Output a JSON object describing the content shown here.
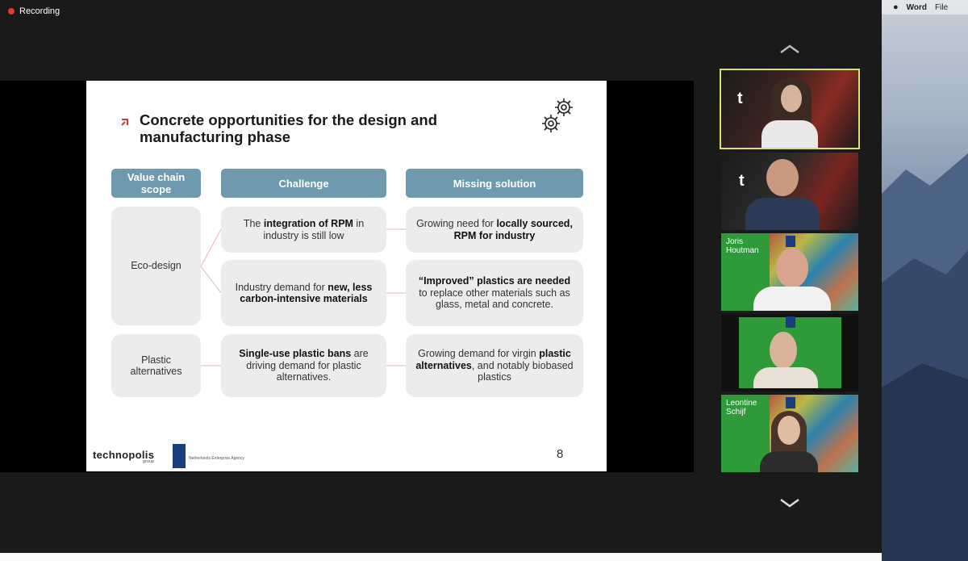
{
  "recording": {
    "label": "Recording"
  },
  "slide": {
    "title": "Concrete opportunities for the design and manufacturing phase",
    "headers": {
      "scope": "Value chain scope",
      "challenge": "Challenge",
      "solution": "Missing solution"
    },
    "scopes": {
      "eco": "Eco-design",
      "plastic": "Plastic alternatives"
    },
    "challenges": [
      {
        "pre": "The ",
        "bold": "integration of RPM",
        "post": " in industry is still low"
      },
      {
        "pre": "Industry demand for ",
        "bold": "new, less carbon-intensive materials",
        "post": ""
      },
      {
        "pre": "",
        "bold": "Single-use plastic bans",
        "post": " are driving demand for plastic alternatives."
      }
    ],
    "solutions": [
      {
        "pre": "Growing need for ",
        "bold": "locally sourced, RPM for industry",
        "post": ""
      },
      {
        "pre": "",
        "bold": "“Improved” plastics are needed",
        "post": " to replace other materials such as glass, metal and concrete."
      },
      {
        "pre": "Growing demand for virgin ",
        "bold": "plastic alternatives",
        "post": ", and notably biobased plastics"
      }
    ],
    "footer": {
      "logo": "technopolis",
      "logo_sub": "group",
      "agency": "Netherlands Enterprise Agency",
      "page": "8"
    }
  },
  "participants": [
    {
      "name": "",
      "active": true
    },
    {
      "name": "",
      "active": false
    },
    {
      "name": "Joris Houtman",
      "active": false
    },
    {
      "name": "",
      "active": false
    },
    {
      "name": "Leontine Schijf",
      "active": false
    }
  ],
  "desktop_menu": {
    "app": "Word",
    "file": "File"
  },
  "icons": [
    "record-dot-icon",
    "gears-icon",
    "chevron-up-icon",
    "chevron-down-icon",
    "apple-icon"
  ],
  "colors": {
    "header": "#6f99ae",
    "accent": "#d8333a",
    "active_border": "#d8e26b"
  }
}
